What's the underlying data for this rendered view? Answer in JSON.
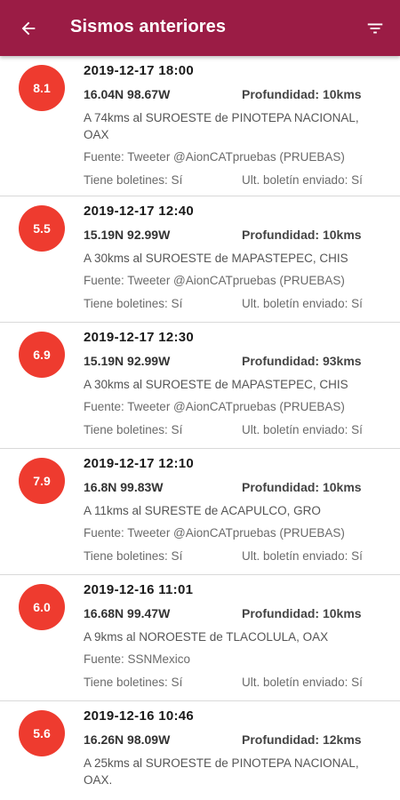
{
  "appbar": {
    "title": "Sismos anteriores",
    "back_icon": "arrow-left-icon",
    "filter_icon": "filter-icon",
    "color": "#9b1c45"
  },
  "badge_color": "#ee3b2f",
  "quakes": [
    {
      "magnitude": "8.1",
      "datetime": "2019-12-17 18:00",
      "coords": "16.04N 98.67W",
      "depth": "Profundidad: 10kms",
      "location": "A 74kms al SUROESTE de PINOTEPA NACIONAL, OAX",
      "source": "Fuente: Tweeter @AionCATpruebas (PRUEBAS)",
      "bulletins": "Tiene boletines: Sí",
      "last_bulletin": "Ult. boletín enviado: Sí"
    },
    {
      "magnitude": "5.5",
      "datetime": "2019-12-17 12:40",
      "coords": "15.19N 92.99W",
      "depth": "Profundidad: 10kms",
      "location": "A 30kms al SUROESTE de MAPASTEPEC, CHIS",
      "source": "Fuente: Tweeter @AionCATpruebas (PRUEBAS)",
      "bulletins": "Tiene boletines: Sí",
      "last_bulletin": "Ult. boletín enviado: Sí"
    },
    {
      "magnitude": "6.9",
      "datetime": "2019-12-17 12:30",
      "coords": "15.19N 92.99W",
      "depth": "Profundidad: 93kms",
      "location": "A 30kms al SUROESTE de MAPASTEPEC, CHIS",
      "source": "Fuente: Tweeter @AionCATpruebas (PRUEBAS)",
      "bulletins": "Tiene boletines: Sí",
      "last_bulletin": "Ult. boletín enviado: Sí"
    },
    {
      "magnitude": "7.9",
      "datetime": "2019-12-17 12:10",
      "coords": "16.8N 99.83W",
      "depth": "Profundidad: 10kms",
      "location": "A 11kms al SURESTE de ACAPULCO, GRO",
      "source": "Fuente: Tweeter @AionCATpruebas (PRUEBAS)",
      "bulletins": "Tiene boletines: Sí",
      "last_bulletin": "Ult. boletín enviado: Sí"
    },
    {
      "magnitude": "6.0",
      "datetime": "2019-12-16 11:01",
      "coords": "16.68N 99.47W",
      "depth": "Profundidad: 10kms",
      "location": "A 9kms al NOROESTE de TLACOLULA, OAX",
      "source": "Fuente: SSNMexico",
      "bulletins": "Tiene boletines: Sí",
      "last_bulletin": "Ult. boletín enviado: Sí"
    },
    {
      "magnitude": "5.6",
      "datetime": "2019-12-16 10:46",
      "coords": "16.26N 98.09W",
      "depth": "Profundidad: 12kms",
      "location": "A 25kms al SUROESTE de PINOTEPA NACIONAL, OAX.",
      "source": "",
      "bulletins": "",
      "last_bulletin": ""
    }
  ]
}
